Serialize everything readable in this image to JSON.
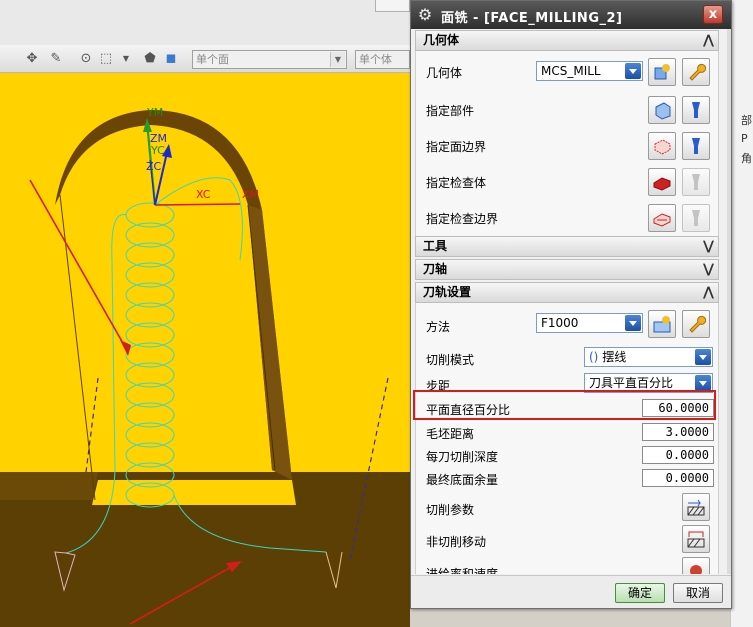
{
  "toolbar": {
    "combo1": "单个面",
    "combo2": "单个体"
  },
  "viewport": {
    "axis_ym": "YM",
    "axis_yc": "YC",
    "axis_zm": "ZM",
    "axis_zc": "ZC",
    "axis_xc": "XC",
    "axis_xm": "XM"
  },
  "right_strip": [
    "部",
    "P",
    "角"
  ],
  "dialog": {
    "title": "面铣 - [FACE_MILLING_2]",
    "sections": {
      "geometry": {
        "header": "几何体",
        "geometry_label": "几何体",
        "geometry_value": "MCS_MILL",
        "specify_part": "指定部件",
        "specify_face_boundary": "指定面边界",
        "specify_check_body": "指定检查体",
        "specify_check_boundary": "指定检查边界"
      },
      "tool": {
        "header": "工具"
      },
      "tool_axis": {
        "header": "刀轴"
      },
      "path_settings": {
        "header": "刀轨设置",
        "method_label": "方法",
        "method_value": "F1000",
        "cut_pattern_label": "切削模式",
        "cut_pattern_value": "摆线",
        "stepover_label": "步距",
        "stepover_value": "刀具平直百分比",
        "flat_diameter_percent_label": "平面直径百分比",
        "flat_diameter_percent_value": "60.0000",
        "blank_distance_label": "毛坯距离",
        "blank_distance_value": "3.0000",
        "depth_per_cut_label": "每刀切削深度",
        "depth_per_cut_value": "0.0000",
        "final_floor_stock_label": "最终底面余量",
        "final_floor_stock_value": "0.0000",
        "cutting_params_label": "切削参数",
        "non_cutting_moves_label": "非切削移动",
        "feeds_speeds_label": "进给率和速度"
      }
    },
    "ok_label": "确定",
    "cancel_label": "取消"
  },
  "colors": {
    "viewport_yellow": "#ffd200",
    "floor_brown": "#5b3f05",
    "toolpath": "#38d8c0",
    "annotation_red": "#d41c1c",
    "title_bar": "#3a3a3a"
  }
}
